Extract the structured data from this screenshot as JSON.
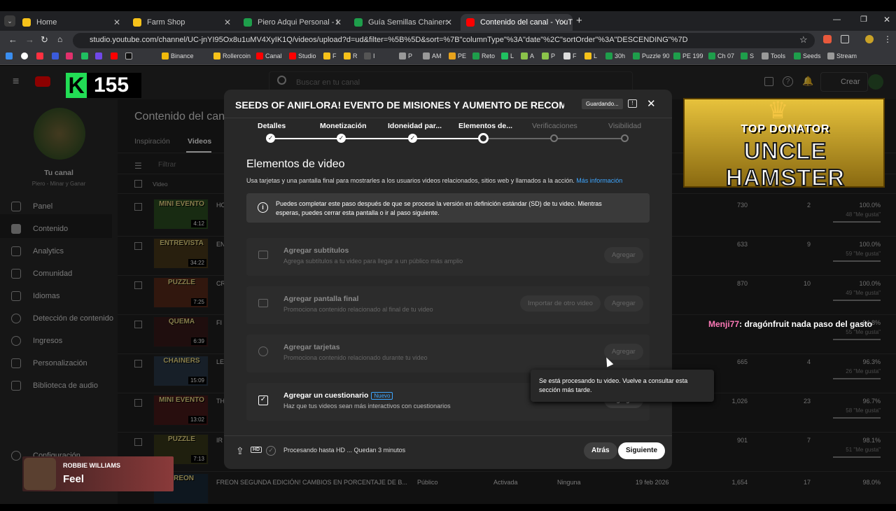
{
  "browser": {
    "tabs": [
      {
        "label": "Home",
        "color": "#f7c21a"
      },
      {
        "label": "Farm Shop",
        "color": "#f7c21a"
      },
      {
        "label": "Piero Adqui Personal - Hojas de",
        "color": "#1e9e4b"
      },
      {
        "label": "Guía Semillas Chainers by Piero",
        "color": "#1e9e4b"
      },
      {
        "label": "Contenido del canal - YouTube",
        "color": "#ff0000"
      }
    ],
    "url": "studio.youtube.com/channel/UC-jnYI95Ox8u1uMV4XyIK1Q/videos/upload?d=ud&filter=%5B%5D&sort=%7B\"columnType\"%3A\"date\"%2C\"sortOrder\"%3A\"DESCENDING\"%7D",
    "bookmarks": [
      "Binance",
      "Rollercoin",
      "Canal",
      "Studio",
      "F",
      "R",
      "I",
      "P",
      "AM",
      "PE",
      "Reto",
      "L",
      "A",
      "P",
      "F",
      "L",
      "30h",
      "Puzzle 90",
      "PE 199",
      "Ch 07",
      "S",
      "Tools",
      "Seeds",
      "Stream"
    ]
  },
  "studio": {
    "search_placeholder": "Buscar en tu canal",
    "create_label": "Crear",
    "page_title": "Contenido del canal",
    "tabs": [
      "Inspiración",
      "Videos"
    ],
    "filter_placeholder": "Filtrar",
    "video_col": "Video",
    "channel": {
      "name": "Tu canal",
      "handle": "Piero - Minar y Ganar"
    },
    "nav": [
      "Panel",
      "Contenido",
      "Analytics",
      "Comunidad",
      "Idiomas",
      "Detección de contenido",
      "Ingresos",
      "Personalización",
      "Biblioteca de audio"
    ],
    "settings": "Configuración",
    "rows": [
      {
        "thumb": "MINI EVENTO",
        "dur": "4:12",
        "title": "HO",
        "views": "730",
        "comments": "2",
        "likes": "100.0%",
        "likes_sub": "48 \"Me gusta\""
      },
      {
        "thumb": "ENTREVISTA",
        "dur": "34:22",
        "title": "EN",
        "views": "633",
        "comments": "9",
        "likes": "100.0%",
        "likes_sub": "59 \"Me gusta\""
      },
      {
        "thumb": "PUZZLE",
        "dur": "7:25",
        "title": "CR",
        "views": "870",
        "comments": "10",
        "likes": "100.0%",
        "likes_sub": "49 \"Me gusta\""
      },
      {
        "thumb": "QUEMA",
        "dur": "6:39",
        "title": "FI",
        "views": "",
        "comments": "",
        "likes": "94.8%",
        "likes_sub": "55 \"Me gusta\""
      },
      {
        "thumb": "CHAINERS",
        "dur": "15:09",
        "title": "LE",
        "views": "665",
        "comments": "4",
        "likes": "96.3%",
        "likes_sub": "26 \"Me gusta\""
      },
      {
        "thumb": "MINI EVENTO",
        "dur": "13:02",
        "title": "TH",
        "views": "1,026",
        "comments": "23",
        "likes": "96.7%",
        "likes_sub": "58 \"Me gusta\""
      },
      {
        "thumb": "PUZZLE",
        "dur": "7:13",
        "title": "IR",
        "views": "901",
        "comments": "7",
        "likes": "98.1%",
        "likes_sub": "51 \"Me gusta\""
      },
      {
        "thumb": "FREON",
        "dur": "",
        "title": "FREON SEGUNDA EDICIÓN! CAMBIOS EN PORCENTAJE DE B...",
        "visibility": "Público",
        "monet": "Activada",
        "restrictions": "Ninguna",
        "date": "19 feb 2026",
        "views": "1,654",
        "comments": "17",
        "likes": "98.0%"
      }
    ]
  },
  "modal": {
    "title": "SEEDS OF ANIFLORA! EVENTO DE MISIONES Y AUMENTO DE RECOMPEN...",
    "saving": "Guardando...",
    "steps": [
      "Detalles",
      "Monetización",
      "Idoneidad par...",
      "Elementos de...",
      "Verificaciones",
      "Visibilidad"
    ],
    "section_title": "Elementos de video",
    "section_desc": "Usa tarjetas y una pantalla final para mostrarles a los usuarios videos relacionados, sitios web y llamados a la acción.",
    "more_info": "Más información",
    "info": "Puedes completar este paso después de que se procese la versión en definición estándar (SD) de tu video. Mientras esperas, puedes cerrar esta pantalla o ir al paso siguiente.",
    "cards": [
      {
        "title": "Agregar subtítulos",
        "desc": "Agrega subtítulos a tu video para llegar a un público más amplio",
        "button": "Agregar"
      },
      {
        "title": "Agregar pantalla final",
        "desc": "Promociona contenido relacionado al final de tu video",
        "button2": "Importar de otro video",
        "button": "Agregar"
      },
      {
        "title": "Agregar tarjetas",
        "desc": "Promociona contenido relacionado durante tu video",
        "button": "Agregar"
      },
      {
        "title": "Agregar un cuestionario",
        "badge": "Nuevo",
        "desc": "Haz que tus videos sean más interactivos con cuestionarios",
        "button": "Agregar"
      }
    ],
    "processing": "Procesando hasta HD ... Quedan 3 minutos",
    "back": "Atrás",
    "next": "Siguiente"
  },
  "tooltip": "Se está procesando tu video. Vuelve a consultar esta sección más tarde.",
  "overlays": {
    "counter_letter": "K",
    "counter": "155",
    "banner_top": "TOP DONATOR",
    "banner_name": "UNCLE HAMSTER",
    "chat_user": "Menji77",
    "chat_msg": ": dragónfruit nada paso del gasto",
    "music_artist": "ROBBIE WILLIAMS",
    "music_song": "Feel"
  }
}
